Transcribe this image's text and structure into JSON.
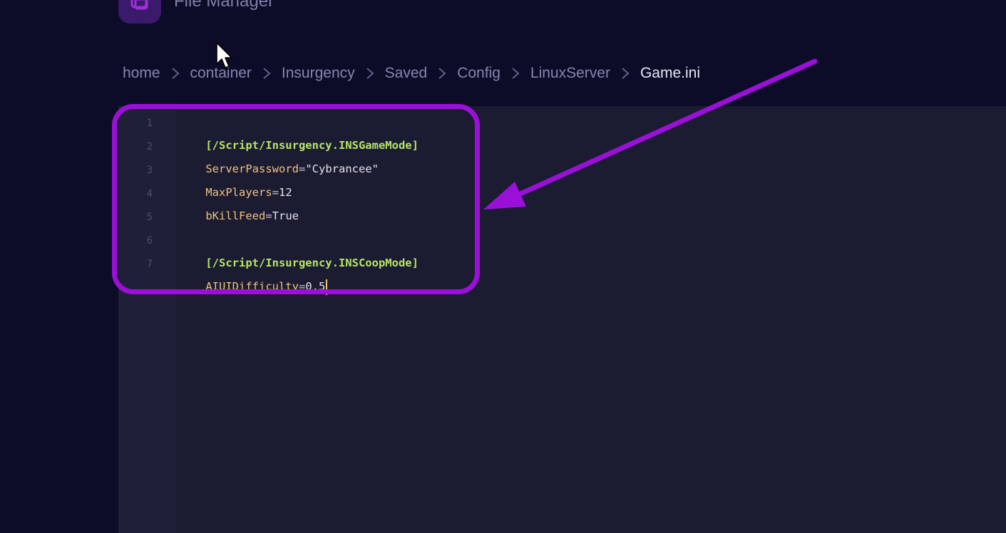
{
  "header": {
    "title": "File Manager",
    "icon": "folder-icon",
    "accent": "#3a1a6a"
  },
  "breadcrumb": {
    "items": [
      "home",
      "container",
      "Insurgency",
      "Saved",
      "Config",
      "LinuxServer"
    ],
    "current": "Game.ini",
    "separator_icon": "chevron-right-icon"
  },
  "editor": {
    "lines": [
      {
        "num": "1",
        "section": "[/Script/Insurgency.INSGameMode]"
      },
      {
        "num": "2",
        "key": "ServerPassword",
        "eq": "=",
        "value": "\"Cybrancee\""
      },
      {
        "num": "3",
        "key": "MaxPlayers",
        "eq": "=",
        "value": "12"
      },
      {
        "num": "4",
        "key": "bKillFeed",
        "eq": "=",
        "value": "True"
      },
      {
        "num": "5"
      },
      {
        "num": "6",
        "section": "[/Script/Insurgency.INSCoopMode]"
      },
      {
        "num": "7",
        "key": "AIUIDifficulty",
        "eq": "=",
        "value": "0.5"
      }
    ]
  },
  "colors": {
    "background": "#0c0c29",
    "editor_bg": "#1b1b32",
    "section": "#b6e46a",
    "key": "#f0c27b",
    "annotation": "#9b10d8"
  }
}
